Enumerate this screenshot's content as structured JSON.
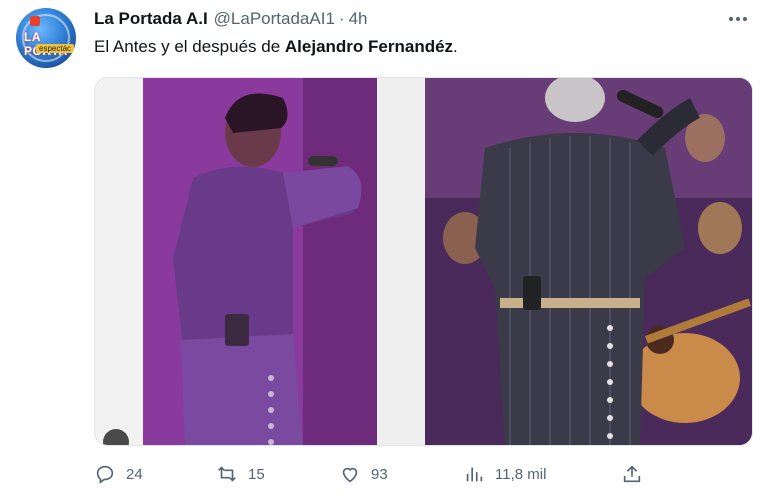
{
  "author": {
    "name": "La Portada A.I",
    "handle": "@LaPortadaAI1",
    "separator": "·",
    "time": "4h",
    "avatar_text": "LA PORTA",
    "avatar_subtext": "espectác"
  },
  "tweet": {
    "text_prefix": "El Antes y el después de ",
    "text_bold": "Alejandro Fernandéz",
    "text_suffix": "."
  },
  "media": {
    "image_count": 2
  },
  "actions": {
    "replies": "24",
    "retweets": "15",
    "likes": "93",
    "views": "11,8 mil"
  },
  "icons": {
    "more": "more-horizontal-icon",
    "reply": "reply-icon",
    "retweet": "retweet-icon",
    "like": "heart-icon",
    "views": "views-chart-icon",
    "share": "share-icon"
  },
  "colors": {
    "text_primary": "#0f1419",
    "text_secondary": "#536471",
    "photo_left": "#8f3aa0",
    "photo_right": "#7a4388"
  }
}
